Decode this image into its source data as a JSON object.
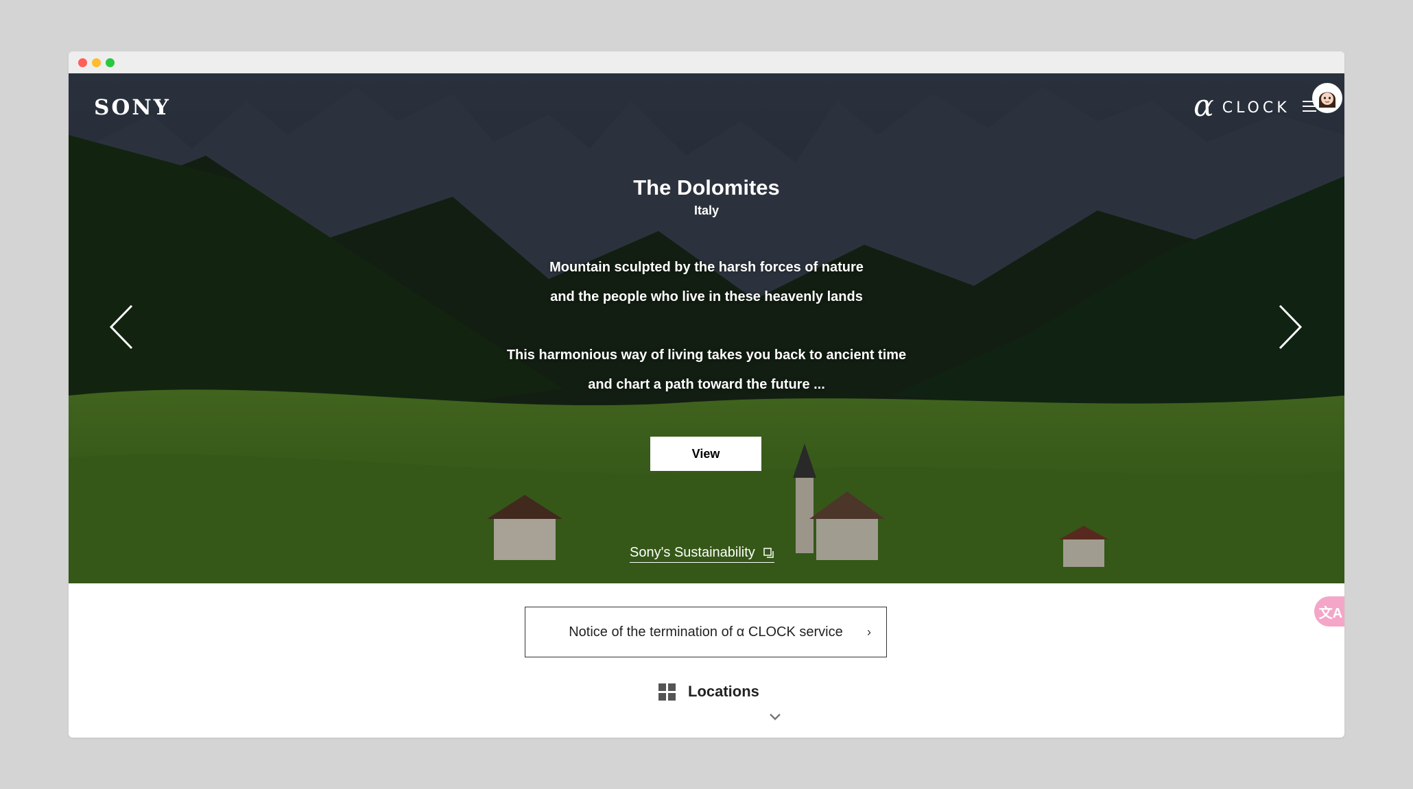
{
  "header": {
    "logo": "SONY",
    "brand_symbol": "α",
    "brand_name": "CLOCK",
    "menu_icon": "hamburger-icon",
    "avatar_icon": "user-avatar-icon"
  },
  "hero": {
    "title": "The Dolomites",
    "subtitle": "Italy",
    "lines": [
      "Mountain sculpted by the harsh forces of nature",
      "and the people who live in these heavenly lands",
      "This harmonious way of living takes you back to ancient time",
      "and chart a path toward the future ..."
    ],
    "view_button": "View",
    "prev_icon": "chevron-left-icon",
    "next_icon": "chevron-right-icon",
    "sustainability_link": "Sony's Sustainability",
    "sustainability_icon": "external-link-icon"
  },
  "notice": {
    "text": "Notice of the termination of α CLOCK service",
    "chevron": "›"
  },
  "locations": {
    "label": "Locations",
    "icon": "grid-icon",
    "expand_icon": "chevron-down-icon"
  },
  "translate": {
    "label": "文A",
    "icon": "translate-icon"
  },
  "colors": {
    "page_bg": "#d4d4d4",
    "accent_pink": "#f4a6c8"
  }
}
